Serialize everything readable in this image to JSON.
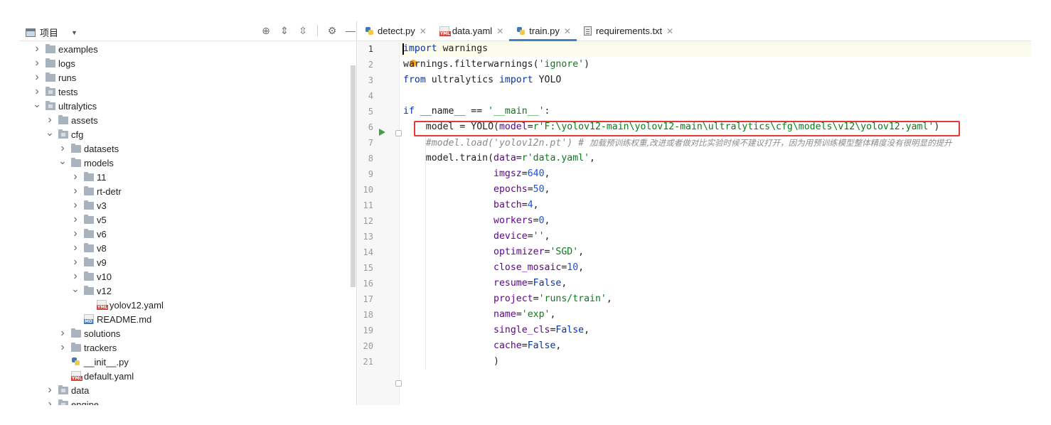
{
  "project_panel": {
    "title": "项目",
    "tools": [
      "target-icon",
      "expand-all-icon",
      "collapse-all-icon",
      "gear-icon",
      "minimize-icon"
    ]
  },
  "tree": [
    {
      "label": "examples",
      "depth": 0,
      "kind": "folder",
      "state": "collapsed"
    },
    {
      "label": "logs",
      "depth": 0,
      "kind": "folder",
      "state": "collapsed"
    },
    {
      "label": "runs",
      "depth": 0,
      "kind": "folder",
      "state": "collapsed"
    },
    {
      "label": "tests",
      "depth": 0,
      "kind": "package",
      "state": "collapsed"
    },
    {
      "label": "ultralytics",
      "depth": 0,
      "kind": "package",
      "state": "expanded"
    },
    {
      "label": "assets",
      "depth": 1,
      "kind": "folder",
      "state": "collapsed"
    },
    {
      "label": "cfg",
      "depth": 1,
      "kind": "package",
      "state": "expanded"
    },
    {
      "label": "datasets",
      "depth": 2,
      "kind": "folder",
      "state": "collapsed"
    },
    {
      "label": "models",
      "depth": 2,
      "kind": "folder",
      "state": "expanded"
    },
    {
      "label": "11",
      "depth": 3,
      "kind": "folder",
      "state": "collapsed"
    },
    {
      "label": "rt-detr",
      "depth": 3,
      "kind": "folder",
      "state": "collapsed"
    },
    {
      "label": "v3",
      "depth": 3,
      "kind": "folder",
      "state": "collapsed"
    },
    {
      "label": "v5",
      "depth": 3,
      "kind": "folder",
      "state": "collapsed"
    },
    {
      "label": "v6",
      "depth": 3,
      "kind": "folder",
      "state": "collapsed"
    },
    {
      "label": "v8",
      "depth": 3,
      "kind": "folder",
      "state": "collapsed"
    },
    {
      "label": "v9",
      "depth": 3,
      "kind": "folder",
      "state": "collapsed"
    },
    {
      "label": "v10",
      "depth": 3,
      "kind": "folder",
      "state": "collapsed"
    },
    {
      "label": "v12",
      "depth": 3,
      "kind": "folder",
      "state": "expanded"
    },
    {
      "label": "yolov12.yaml",
      "depth": 4,
      "kind": "yml",
      "state": "none"
    },
    {
      "label": "README.md",
      "depth": 3,
      "kind": "md",
      "state": "none"
    },
    {
      "label": "solutions",
      "depth": 2,
      "kind": "folder",
      "state": "collapsed"
    },
    {
      "label": "trackers",
      "depth": 2,
      "kind": "folder",
      "state": "collapsed"
    },
    {
      "label": "__init__.py",
      "depth": 2,
      "kind": "py",
      "state": "none"
    },
    {
      "label": "default.yaml",
      "depth": 2,
      "kind": "yml",
      "state": "none"
    },
    {
      "label": "data",
      "depth": 1,
      "kind": "package",
      "state": "collapsed"
    },
    {
      "label": "engine",
      "depth": 1,
      "kind": "package",
      "state": "collapsed"
    }
  ],
  "tabs": [
    {
      "label": "detect.py",
      "icon": "python-file-icon",
      "active": false
    },
    {
      "label": "data.yaml",
      "icon": "yaml-file-icon",
      "active": false
    },
    {
      "label": "train.py",
      "icon": "python-file-icon",
      "active": true
    },
    {
      "label": "requirements.txt",
      "icon": "text-file-icon",
      "active": false
    }
  ],
  "code_lines": [
    [
      [
        "kw",
        "import"
      ],
      [
        "t",
        " warnings"
      ]
    ],
    [
      [
        "t",
        "warnings.filterwarnings("
      ],
      [
        "st",
        "'ignore'"
      ],
      [
        "t",
        ")"
      ]
    ],
    [
      [
        "kw",
        "from"
      ],
      [
        "t",
        " ultralytics "
      ],
      [
        "kw",
        "import"
      ],
      [
        "t",
        " YOLO"
      ]
    ],
    [],
    [
      [
        "kw",
        "if"
      ],
      [
        "t",
        " __name__ == "
      ],
      [
        "st",
        "'__main__'"
      ],
      [
        "t",
        ":"
      ]
    ],
    [
      [
        "t",
        "    model = YOLO("
      ],
      [
        "param",
        "model"
      ],
      [
        "t",
        "="
      ],
      [
        "st",
        "r'F:\\yolov12-main\\yolov12-main\\ultralytics\\cfg\\models\\v12\\yolov12.yaml'"
      ],
      [
        "t",
        ")"
      ]
    ],
    [
      [
        "t",
        "    "
      ],
      [
        "cm",
        "#model.load('yolov12n.pt') # "
      ],
      [
        "cmcn",
        "加载预训练权重,改进或者做对比实验时候不建议打开，因为用预训练模型整体精度没有很明显的提升"
      ]
    ],
    [
      [
        "t",
        "    model.train("
      ],
      [
        "param",
        "data"
      ],
      [
        "t",
        "="
      ],
      [
        "st",
        "r'data.yaml'"
      ],
      [
        "t",
        ","
      ]
    ],
    [
      [
        "t",
        "                "
      ],
      [
        "param",
        "imgsz"
      ],
      [
        "t",
        "="
      ],
      [
        "num",
        "640"
      ],
      [
        "t",
        ","
      ]
    ],
    [
      [
        "t",
        "                "
      ],
      [
        "param",
        "epochs"
      ],
      [
        "t",
        "="
      ],
      [
        "num",
        "50"
      ],
      [
        "t",
        ","
      ]
    ],
    [
      [
        "t",
        "                "
      ],
      [
        "param",
        "batch"
      ],
      [
        "t",
        "="
      ],
      [
        "num",
        "4"
      ],
      [
        "t",
        ","
      ]
    ],
    [
      [
        "t",
        "                "
      ],
      [
        "param",
        "workers"
      ],
      [
        "t",
        "="
      ],
      [
        "num",
        "0"
      ],
      [
        "t",
        ","
      ]
    ],
    [
      [
        "t",
        "                "
      ],
      [
        "param",
        "device"
      ],
      [
        "t",
        "="
      ],
      [
        "st",
        "''"
      ],
      [
        "t",
        ","
      ]
    ],
    [
      [
        "t",
        "                "
      ],
      [
        "param",
        "optimizer"
      ],
      [
        "t",
        "="
      ],
      [
        "st",
        "'SGD'"
      ],
      [
        "t",
        ","
      ]
    ],
    [
      [
        "t",
        "                "
      ],
      [
        "param",
        "close_mosaic"
      ],
      [
        "t",
        "="
      ],
      [
        "num",
        "10"
      ],
      [
        "t",
        ","
      ]
    ],
    [
      [
        "t",
        "                "
      ],
      [
        "param",
        "resume"
      ],
      [
        "t",
        "="
      ],
      [
        "kw",
        "False"
      ],
      [
        "t",
        ","
      ]
    ],
    [
      [
        "t",
        "                "
      ],
      [
        "param",
        "project"
      ],
      [
        "t",
        "="
      ],
      [
        "st",
        "'runs/train'"
      ],
      [
        "t",
        ","
      ]
    ],
    [
      [
        "t",
        "                "
      ],
      [
        "param",
        "name"
      ],
      [
        "t",
        "="
      ],
      [
        "st",
        "'exp'"
      ],
      [
        "t",
        ","
      ]
    ],
    [
      [
        "t",
        "                "
      ],
      [
        "param",
        "single_cls"
      ],
      [
        "t",
        "="
      ],
      [
        "kw",
        "False"
      ],
      [
        "t",
        ","
      ]
    ],
    [
      [
        "t",
        "                "
      ],
      [
        "param",
        "cache"
      ],
      [
        "t",
        "="
      ],
      [
        "kw",
        "False"
      ],
      [
        "t",
        ","
      ]
    ],
    [
      [
        "t",
        "                )"
      ]
    ]
  ],
  "colors": {
    "keyword": "#0033b3",
    "string": "#067d17",
    "number": "#1750eb",
    "param": "#660099",
    "comment": "#8c8c8c",
    "highlight_box": "#e53935",
    "active_tab_underline": "#4083c9"
  }
}
